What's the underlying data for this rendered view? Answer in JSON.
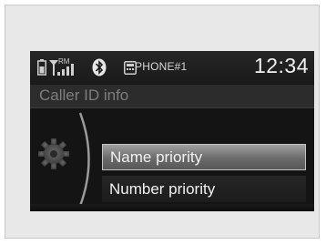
{
  "status_bar": {
    "phone_name": "PHONE#1",
    "clock": "12:34",
    "signal_carrier": "RM",
    "icons": [
      "battery-icon",
      "signal-icon",
      "bluetooth-icon",
      "phone-icon"
    ]
  },
  "title": "Caller ID info",
  "menu": {
    "items": [
      {
        "label": "Name priority",
        "selected": true
      },
      {
        "label": "Number priority",
        "selected": false
      }
    ]
  },
  "colors": {
    "screen_bg": "#141414",
    "title_text": "#7e7e7e",
    "selected_bg": "#6a6a6a",
    "text": "#f2f2f2"
  }
}
